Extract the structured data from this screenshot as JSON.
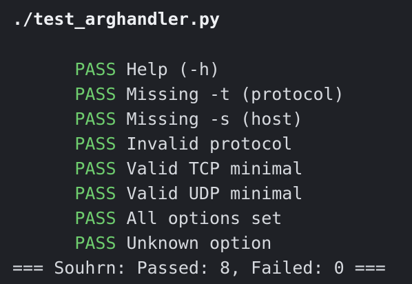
{
  "colors": {
    "background": "#1f2126",
    "pass": "#6fce6f",
    "text": "#d6d9de"
  },
  "command": "./test_arghandler.py",
  "results": [
    {
      "status": "PASS",
      "name": "Help (-h)"
    },
    {
      "status": "PASS",
      "name": "Missing -t (protocol)"
    },
    {
      "status": "PASS",
      "name": "Missing -s (host)"
    },
    {
      "status": "PASS",
      "name": "Invalid protocol"
    },
    {
      "status": "PASS",
      "name": "Valid TCP minimal"
    },
    {
      "status": "PASS",
      "name": "Valid UDP minimal"
    },
    {
      "status": "PASS",
      "name": "All options set"
    },
    {
      "status": "PASS",
      "name": "Unknown option"
    }
  ],
  "summary": "=== Souhrn: Passed: 8, Failed: 0 ==="
}
